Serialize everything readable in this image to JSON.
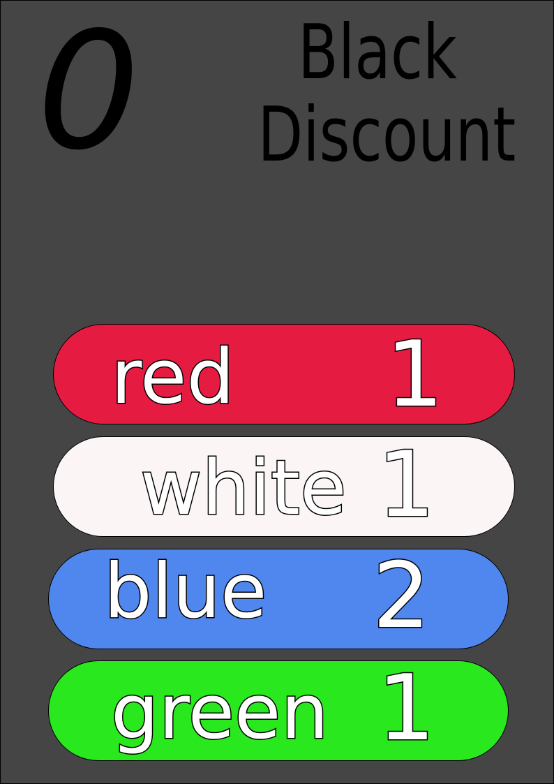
{
  "card": {
    "cost": "0",
    "title_line1": "Black",
    "title_line2": "Discount"
  },
  "rows": [
    {
      "label": "red",
      "count": "1",
      "color": "#e51b42"
    },
    {
      "label": "white",
      "count": "1",
      "color": "#fbf5f5"
    },
    {
      "label": "blue",
      "count": "2",
      "color": "#4f87ef"
    },
    {
      "label": "green",
      "count": "1",
      "color": "#2ae81e"
    }
  ]
}
